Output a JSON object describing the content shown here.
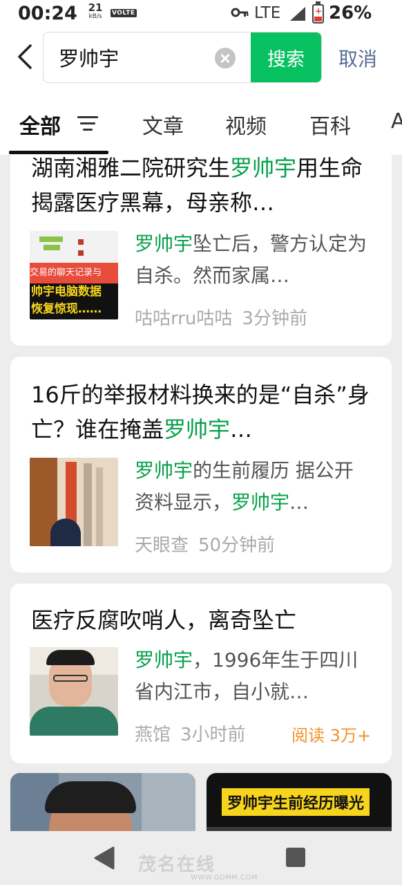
{
  "status_bar": {
    "time": "00:24",
    "net_speed_value": "21",
    "net_speed_unit": "kB/s",
    "volte": "VOLTE",
    "network": "LTE",
    "battery": "26%"
  },
  "search": {
    "query": "罗帅宇",
    "search_button": "搜索",
    "cancel": "取消"
  },
  "tabs": [
    {
      "label": "全部"
    },
    {
      "label": "文章"
    },
    {
      "label": "视频"
    },
    {
      "label": "百科"
    },
    {
      "label": "A"
    }
  ],
  "results": [
    {
      "title_pre": "湖南湘雅二院研究生",
      "title_hl": "罗帅宇",
      "title_post": "用生命揭露医疗黑幕，母亲称…",
      "snippet_hl": "罗帅宇",
      "snippet": "坠亡后，警方认定为自杀。然而家属…",
      "thumb_line1": "交易的聊天记录与",
      "thumb_line2": "帅宇电脑数据",
      "thumb_line3": "恢复惊现……",
      "source": "咕咕rru咕咕",
      "time": "3分钟前"
    },
    {
      "title_pre": "16斤的举报材料换来的是“自杀”身亡？谁在掩盖",
      "title_hl": "罗帅宇",
      "title_post": "…",
      "snippet_hl": "罗帅宇",
      "snippet": "的生前履历 据公开资料显示，",
      "snippet_hl2": "罗帅宇",
      "snippet_post": "…",
      "source": "天眼查",
      "time": "50分钟前"
    },
    {
      "title": "医疗反腐吹哨人，离奇坠亡",
      "snippet_hl": "罗帅宇",
      "snippet": "，1996年生于四川省内江市，自小就…",
      "source": "燕馆",
      "time": "3小时前",
      "reads": "阅读 3万+"
    }
  ],
  "videos": [
    {
      "title": ""
    },
    {
      "title": "罗帅宇生前经历曝光"
    }
  ],
  "watermark": {
    "text": "茂名在线",
    "url": "WWW.GDMM.COM"
  },
  "colors": {
    "accent": "#07c160",
    "highlight": "#07a04b",
    "cancel": "#576b95",
    "reads": "#f2922b"
  }
}
